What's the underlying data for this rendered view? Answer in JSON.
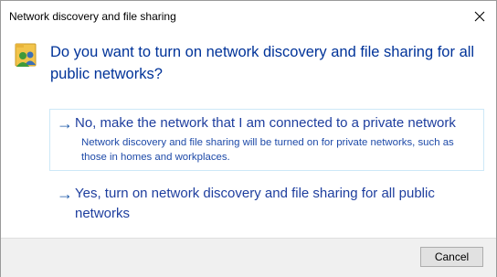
{
  "window": {
    "title": "Network discovery and file sharing",
    "close_icon": "close-icon"
  },
  "prompt": {
    "icon": "network-users-icon",
    "question": "Do you want to turn on network discovery and file sharing for all public networks?"
  },
  "options": [
    {
      "icon": "arrow-right-icon",
      "title": "No, make the network that I am connected to a private network",
      "description": "Network discovery and file sharing will be turned on for private networks, such as those in homes and workplaces."
    },
    {
      "icon": "arrow-right-icon",
      "title": "Yes, turn on network discovery and file sharing for all public networks"
    }
  ],
  "footer": {
    "cancel_label": "Cancel"
  },
  "colors": {
    "heading": "#003399",
    "link": "#1e3e9e",
    "arrow": "#1e5aa8",
    "hover_border": "#cde8f7",
    "footer_bg": "#f0f0f0"
  }
}
